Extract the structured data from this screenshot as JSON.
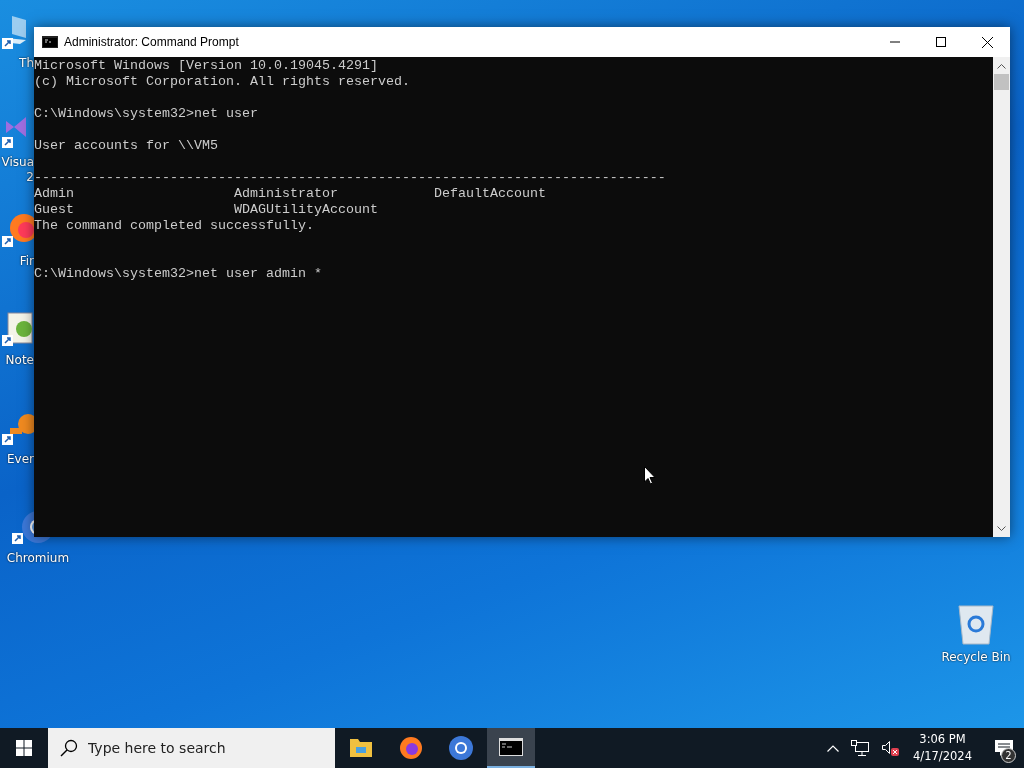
{
  "desktop_icons": [
    {
      "kind": "monitor",
      "label": "Th"
    },
    {
      "kind": "studio",
      "label": "Visua\n2"
    },
    {
      "kind": "firefox",
      "label": "Fir"
    },
    {
      "kind": "notepad",
      "label": "Note"
    },
    {
      "kind": "everything",
      "label": "Ever"
    },
    {
      "kind": "chromium",
      "label": "Chromium"
    }
  ],
  "recycle_bin": {
    "label": "Recycle Bin"
  },
  "window": {
    "title": "Administrator: Command Prompt",
    "console_lines": [
      {
        "text": "Microsoft Windows [Version 10.0.19045.4291]"
      },
      {
        "text": "(c) Microsoft Corporation. All rights reserved."
      },
      {
        "kind": "blank"
      },
      {
        "text": "C:\\Windows\\system32>net user"
      },
      {
        "kind": "blank"
      },
      {
        "text": "User accounts for \\\\VM5"
      },
      {
        "kind": "blank"
      },
      {
        "text": "-------------------------------------------------------------------------------"
      },
      {
        "text": "Admin                    Administrator            DefaultAccount"
      },
      {
        "text": "Guest                    WDAGUtilityAccount"
      },
      {
        "text": "The command completed successfully."
      },
      {
        "kind": "blank"
      },
      {
        "kind": "blank"
      },
      {
        "text": "C:\\Windows\\system32>net user admin *"
      }
    ]
  },
  "taskbar": {
    "search": {
      "placeholder": "Type here to search"
    },
    "apps": [
      {
        "kind": "explorer",
        "selected": false
      },
      {
        "kind": "firefox",
        "selected": false
      },
      {
        "kind": "chromium",
        "selected": false
      },
      {
        "kind": "cmd",
        "selected": true
      }
    ],
    "clock": {
      "time": "3:06 PM",
      "date": "4/17/2024"
    },
    "notifications": {
      "count": "2"
    }
  }
}
